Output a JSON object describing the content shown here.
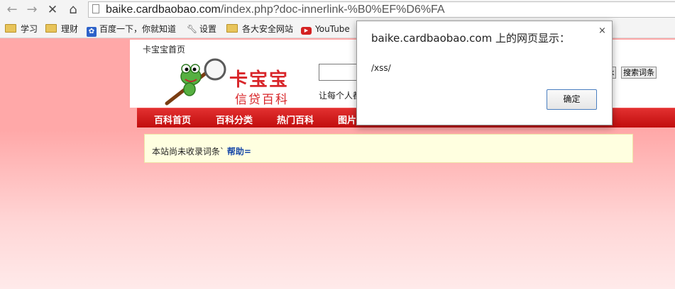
{
  "browser": {
    "url_host": "baike.cardbaobao.com",
    "url_path": "/index.php?doc-innerlink-%B0%EF%D6%FA",
    "bookmarks": [
      {
        "label": "学习",
        "icon": "folder-icon"
      },
      {
        "label": "理财",
        "icon": "folder-icon"
      },
      {
        "label": "百度一下，你就知道",
        "icon": "baidu-paw-icon"
      },
      {
        "label": "设置",
        "icon": "wrench-icon"
      },
      {
        "label": "各大安全网站",
        "icon": "folder-icon"
      },
      {
        "label": "YouTube",
        "icon": "youtube-icon"
      }
    ]
  },
  "site": {
    "home_link": "卡宝宝首页",
    "logo_title": "卡宝宝",
    "logo_subtitle": "信贷百科",
    "slogan": "让每个人都",
    "btn_partial": "k",
    "btn_search_entry": "搜索词条",
    "nav": [
      "百科首页",
      "百科分类",
      "热门百科",
      "图片"
    ],
    "notice_text": "本站尚未收录词条`",
    "notice_link": "帮助="
  },
  "dialog": {
    "title": "baike.cardbaobao.com 上的网页显示：",
    "message": "/xss/",
    "ok_label": "确定",
    "close_glyph": "×"
  },
  "colors": {
    "nav_red": "#d21a1a",
    "logo_red": "#d8262a",
    "page_pink": "#ffa8a8",
    "notice_bg": "#ffffe0",
    "link_blue": "#1a4aa8"
  }
}
